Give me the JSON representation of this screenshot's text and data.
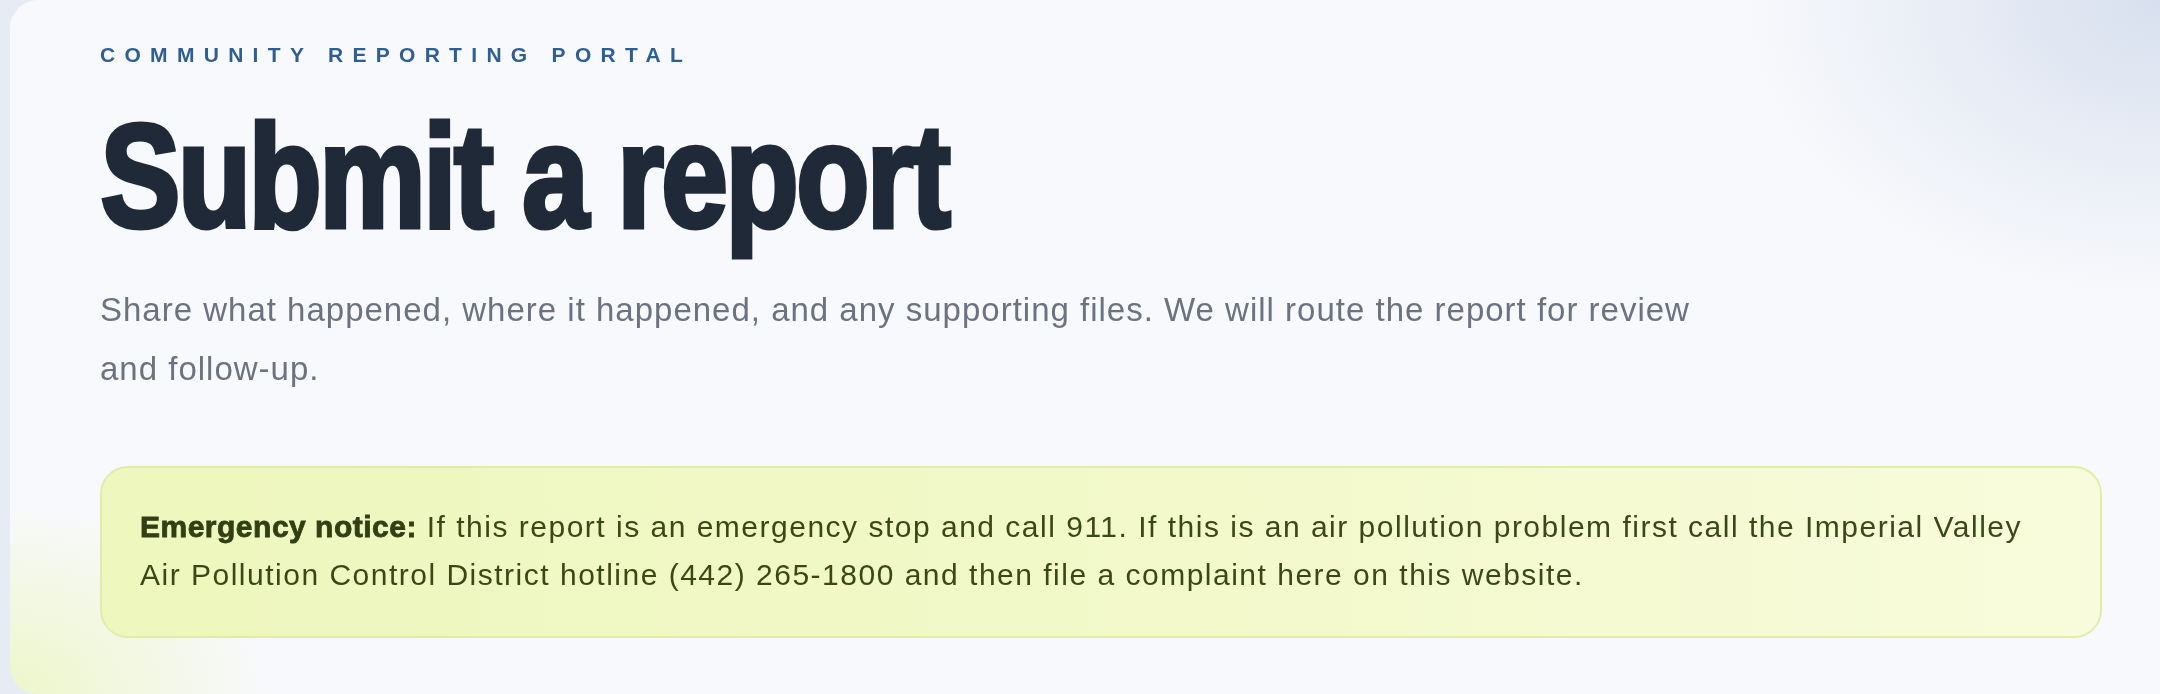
{
  "header": {
    "eyebrow": "COMMUNITY REPORTING PORTAL",
    "title": "Submit a report",
    "subtitle": "Share what happened, where it happened, and any supporting files. We will route the report for review and follow-up."
  },
  "notice": {
    "text": "**Emergency notice:** If this report is an emergency stop and call 911. If this is an air pollution problem first call the Imperial Valley Air Pollution Control District hotline (442) 265-1800 and then file a complaint here on this website."
  }
}
